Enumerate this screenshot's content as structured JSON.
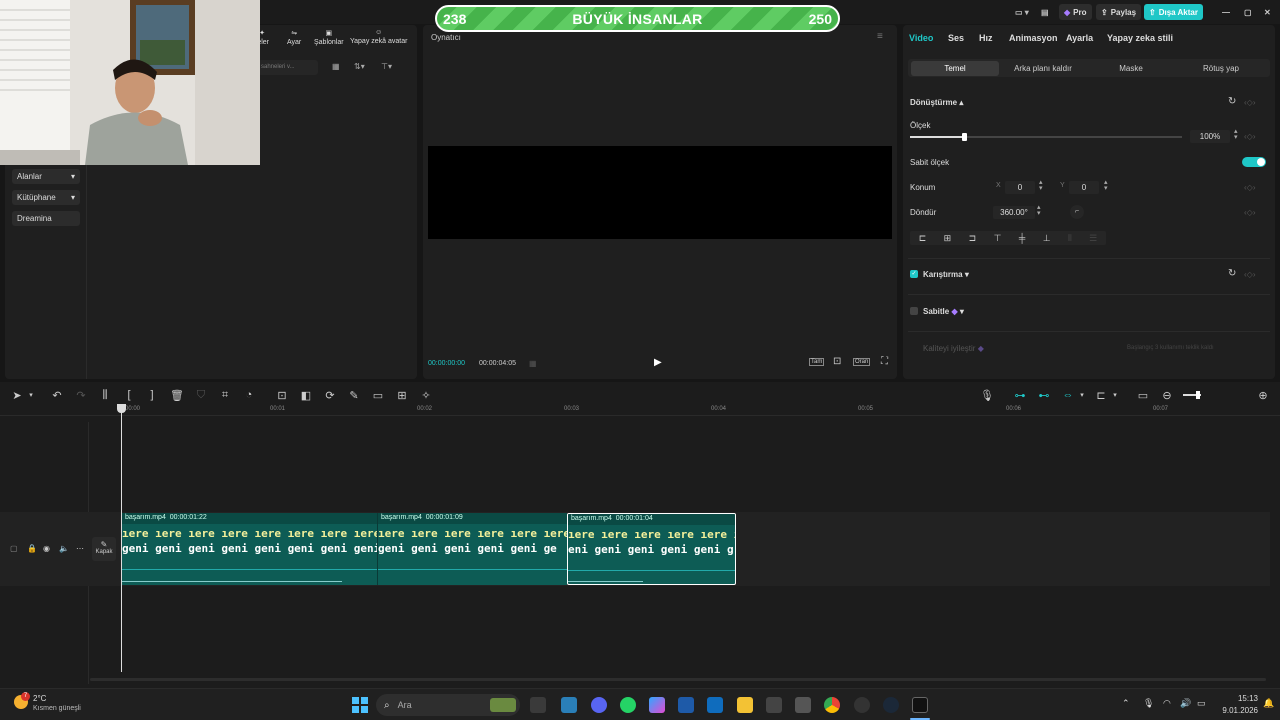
{
  "banner": {
    "left": "238",
    "title": "BÜYÜK İNSANLAR",
    "right": "250",
    "progress": 0.95
  },
  "topbar": {
    "pro": "Pro",
    "share": "Paylaş",
    "export": "Dışa Aktar"
  },
  "library": {
    "tabs": [
      "reler",
      "Ayar",
      "Şablonlar",
      "Yapay zekâ avatar"
    ],
    "search_placeholder": "sahneleri v...",
    "side": [
      "Alanlar",
      "Kütüphane",
      "Dreamina"
    ]
  },
  "player": {
    "title": "Oynatıcı",
    "current": "00:00:00:00",
    "total": "00:00:04:05",
    "full_label": "Tam",
    "ratio_label": "Oran"
  },
  "props": {
    "tabs": [
      "Video",
      "Ses",
      "Hız",
      "Animasyon",
      "Ayarla",
      "Yapay zeka stili"
    ],
    "subtabs": [
      "Temel",
      "Arka planı kaldır",
      "Maske",
      "Rötuş yap"
    ],
    "transform": "Dönüştürme",
    "scale_label": "Ölçek",
    "scale_value": "100%",
    "scale_level": 0.2,
    "uniform_scale": "Sabit ölçek",
    "position_label": "Konum",
    "x_label": "X",
    "x_value": "0",
    "y_label": "Y",
    "y_value": "0",
    "rotate_label": "Döndür",
    "rotate_value": "360.00°",
    "blend": "Karıştırma",
    "stabilize": "Sabitle",
    "enhance": "Kaliteyi iyileştir",
    "enhance_hint": "Başlangıç 3 kullanımı teklik kaldı"
  },
  "timeline": {
    "ruler": [
      "00:00",
      "00:01",
      "00:02",
      "00:03",
      "00:04",
      "00:05",
      "00:06",
      "00:07"
    ],
    "cover_label": "Kapak",
    "clips": [
      {
        "name": "başarım.mp4",
        "duration": "00:00:01:22",
        "line1": "ıere ıere ıere ıere ıere ıere ıere ıere",
        "line2": "geni geni geni geni geni geni geni geni"
      },
      {
        "name": "başarım.mp4",
        "duration": "00:00:01:09",
        "line1": "ıere ıere ıere ıere ıere ıere",
        "line2": "geni geni geni geni geni ge"
      },
      {
        "name": "başarım.mp4",
        "duration": "00:00:01:04",
        "line1": "ıere ıere ıere ıere ıere ıere",
        "line2": "eni geni geni geni geni g"
      }
    ]
  },
  "taskbar": {
    "weather_temp": "2°C",
    "weather_desc": "Kısmen güneşli",
    "search": "Ara",
    "time": "15:13",
    "date": "9.01.2026",
    "badge": "7"
  },
  "colors": {
    "accent": "#1fc7c7",
    "banner": "#4db851",
    "clip": "#0d5c55"
  }
}
